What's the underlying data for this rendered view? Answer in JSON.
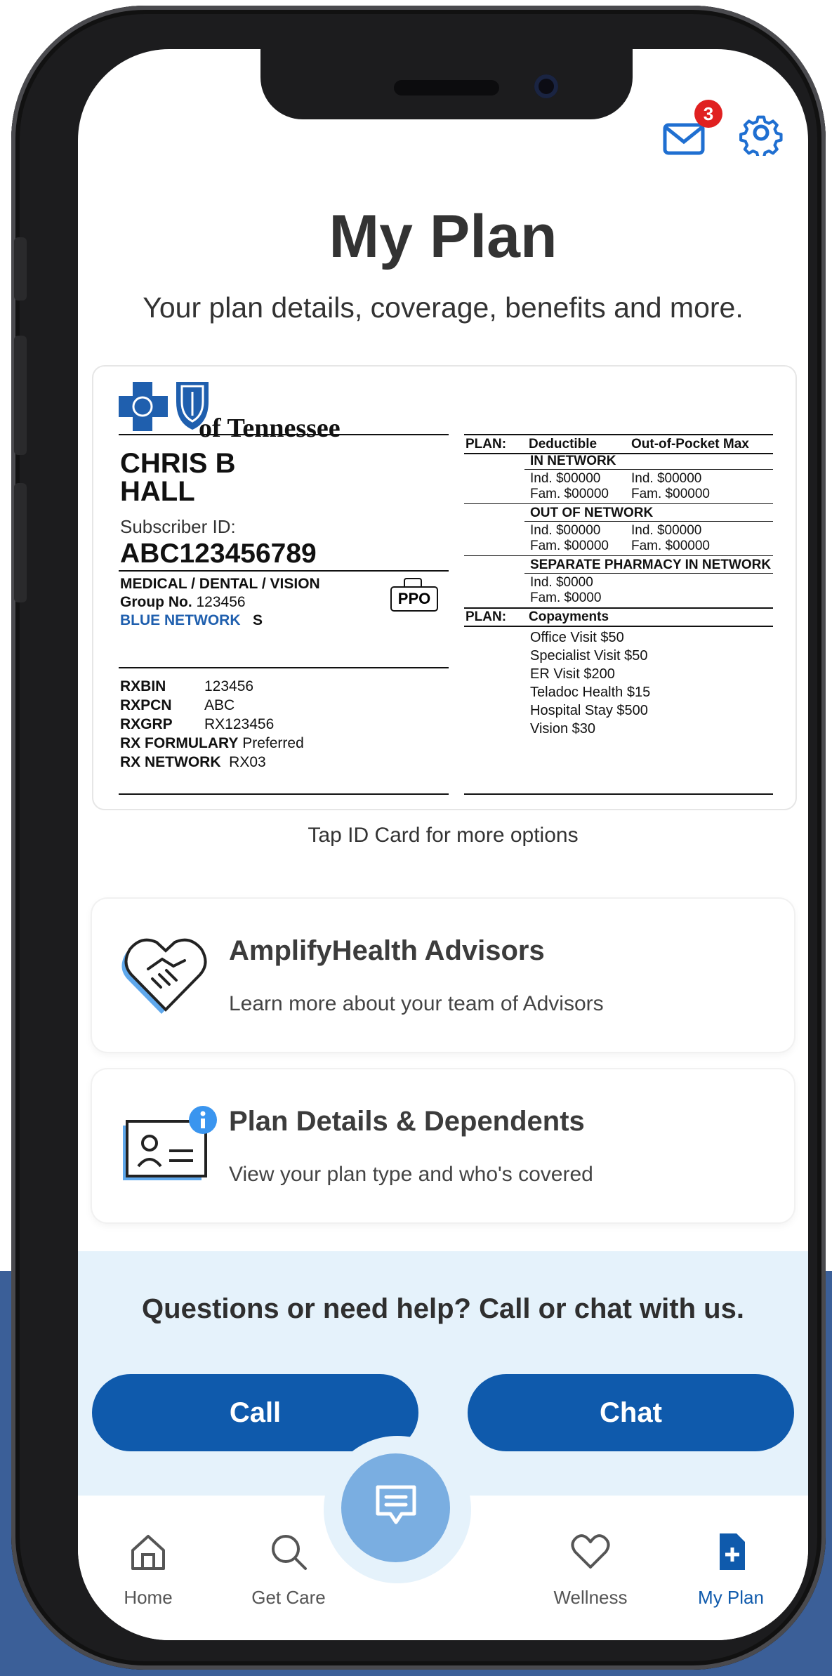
{
  "header": {
    "title": "My Plan",
    "subtitle": "Your plan details, coverage, benefits and more.",
    "notification_count": "3"
  },
  "id_card": {
    "logo_text": "of Tennessee",
    "member_name_line1": "CHRIS B",
    "member_name_line2": "HALL",
    "subscriber_label": "Subscriber ID:",
    "subscriber_id": "ABC123456789",
    "coverage_types": "MEDICAL / DENTAL / VISION",
    "group_label": "Group No.",
    "group_no": "123456",
    "network": "BLUE NETWORK",
    "network_code": "S",
    "plan_type": "PPO",
    "rx": [
      {
        "label": "RXBIN",
        "value": "123456"
      },
      {
        "label": "RXPCN",
        "value": "ABC"
      },
      {
        "label": "RXGRP",
        "value": "RX123456"
      },
      {
        "label": "RX FORMULARY",
        "value": "Preferred"
      },
      {
        "label": "RX NETWORK",
        "value": "RX03"
      }
    ],
    "plan_label": "PLAN:",
    "deductible_header": "Deductible",
    "oop_header": "Out-of-Pocket Max",
    "in_network_label": "IN NETWORK",
    "in_ind_ded": "Ind. $00000",
    "in_ind_oop": "Ind. $00000",
    "in_fam_ded": "Fam. $00000",
    "in_fam_oop": "Fam. $00000",
    "out_network_label": "OUT OF NETWORK",
    "out_ind_ded": "Ind. $00000",
    "out_ind_oop": "Ind. $00000",
    "out_fam_ded": "Fam. $00000",
    "out_fam_oop": "Fam. $00000",
    "pharmacy_label": "SEPARATE PHARMACY IN NETWORK",
    "ph_ind": "Ind. $0000",
    "ph_fam": "Fam. $0000",
    "copay_plan_label": "PLAN:",
    "copay_header": "Copayments",
    "copays": [
      "Office Visit $50",
      "Specialist Visit $50",
      "ER Visit $200",
      "Teladoc Health $15",
      "Hospital Stay $500",
      "Vision $30"
    ]
  },
  "tap_hint": "Tap ID Card for more options",
  "tiles": [
    {
      "title": "AmplifyHealth Advisors",
      "description": "Learn more about your team of Advisors",
      "icon": "handshake-heart-icon"
    },
    {
      "title": "Plan Details & Dependents",
      "description": "View your plan type and who's covered",
      "icon": "id-card-info-icon"
    }
  ],
  "help": {
    "question": "Questions or need help? Call or chat with us.",
    "call_label": "Call",
    "chat_label": "Chat"
  },
  "nav": {
    "items": [
      {
        "label": "Home",
        "icon": "home-icon"
      },
      {
        "label": "Get Care",
        "icon": "search-icon"
      },
      {
        "label": "Wellness",
        "icon": "heart-icon"
      },
      {
        "label": "My Plan",
        "icon": "document-plus-icon"
      }
    ],
    "active": "My Plan",
    "fab_icon": "chat-bubble-icon"
  },
  "colors": {
    "primary": "#0f5aac",
    "accent_blue": "#1f6fd1",
    "help_bg": "#e5f2fb",
    "badge_red": "#e02020",
    "outer_band": "#3b5f98"
  }
}
